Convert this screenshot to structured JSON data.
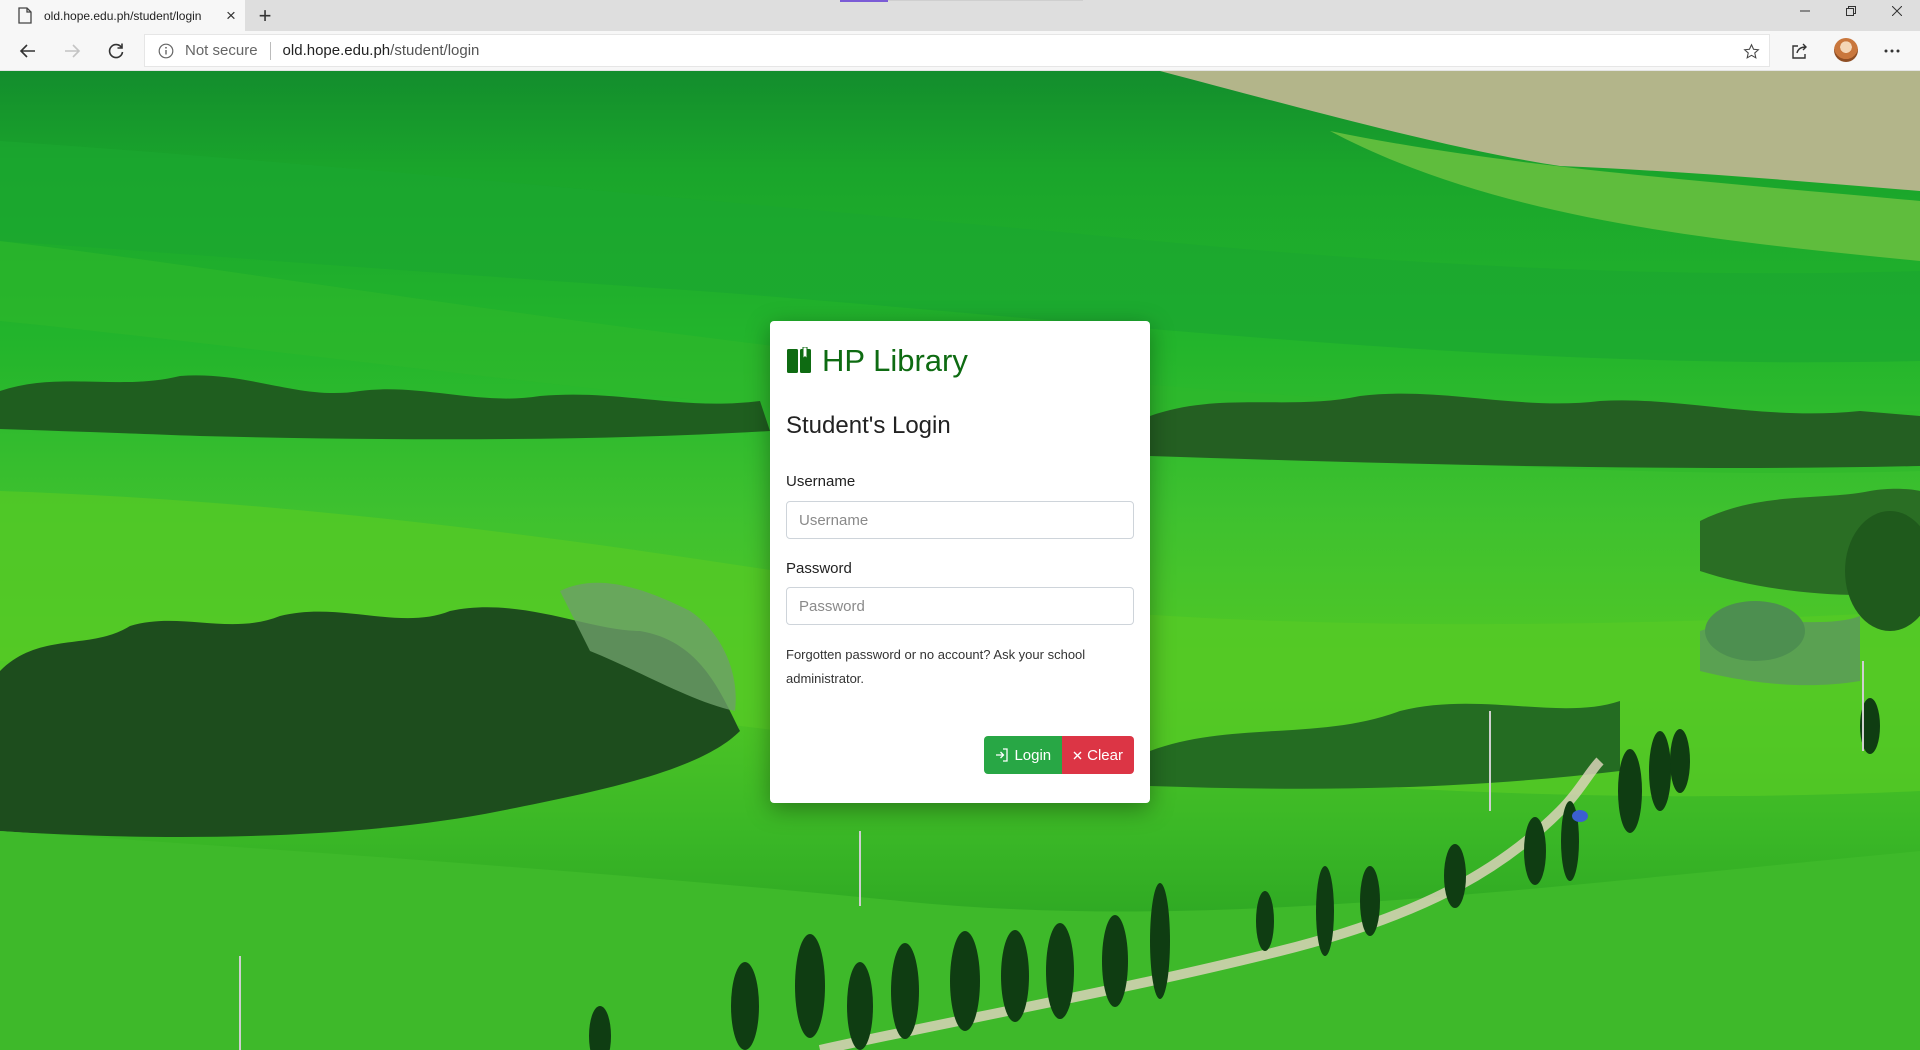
{
  "browser": {
    "tab_title": "old.hope.edu.ph/student/login",
    "new_tab_glyph": "+",
    "close_tab_glyph": "×",
    "security_label": "Not secure",
    "url_host": "old.hope.edu.ph",
    "url_path": "/student/login",
    "icons": [
      "back-icon",
      "forward-icon",
      "refresh-icon",
      "info-icon",
      "star-icon",
      "share-icon",
      "more-icon",
      "minimize-icon",
      "restore-icon",
      "close-icon"
    ]
  },
  "login": {
    "brand": "HP Library",
    "heading": "Student's Login",
    "username_label": "Username",
    "username_placeholder": "Username",
    "password_label": "Password",
    "password_placeholder": "Password",
    "help_text": "Forgotten password or no account? Ask your school administrator.",
    "login_button": "Login",
    "clear_button": "Clear"
  },
  "colors": {
    "brand_green": "#0e6b12",
    "login_button": "#28a745",
    "clear_button": "#dc3545"
  }
}
